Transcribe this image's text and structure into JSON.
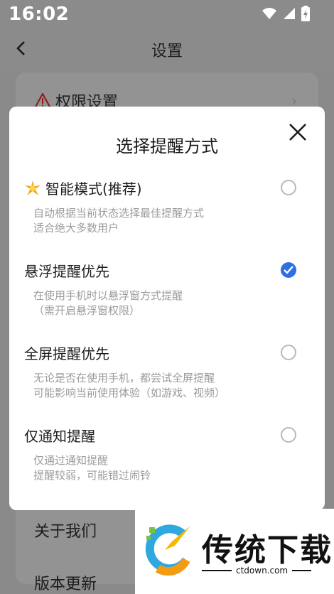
{
  "status_bar": {
    "time": "16:02",
    "icons": [
      "wifi-icon",
      "signal-icon",
      "battery-charging-icon"
    ]
  },
  "header": {
    "title": "设置",
    "back_icon": "chevron-left-icon"
  },
  "background_list": {
    "permission_label": "权限设置",
    "about_label": "关于我们",
    "update_label": "版本更新"
  },
  "dialog": {
    "title": "选择提醒方式",
    "options": [
      {
        "icon": "sparkle-emoji",
        "title": "智能模式(推荐)",
        "desc_line1": "自动根据当前状态选择最佳提醒方式",
        "desc_line2": "适合绝大多数用户",
        "selected": false
      },
      {
        "title": "悬浮提醒优先",
        "desc_line1": "在使用手机时以悬浮窗方式提醒",
        "desc_line2": "（需开启悬浮窗权限）",
        "selected": true
      },
      {
        "title": "全屏提醒优先",
        "desc_line1": "无论是否在使用手机，都尝试全屏提醒",
        "desc_line2": "可能影响当前使用体验（如游戏、视频）",
        "selected": false
      },
      {
        "title": "仅通知提醒",
        "desc_line1": "仅通过通知提醒",
        "desc_line2": "提醒较弱，可能错过闹铃",
        "selected": false
      }
    ]
  },
  "watermark": {
    "brand": "传统下载",
    "url": "ctdown.com"
  },
  "colors": {
    "accent": "#2f6fe4",
    "scrim": "#8b8b8b",
    "desc_text": "#9b9b9b"
  }
}
